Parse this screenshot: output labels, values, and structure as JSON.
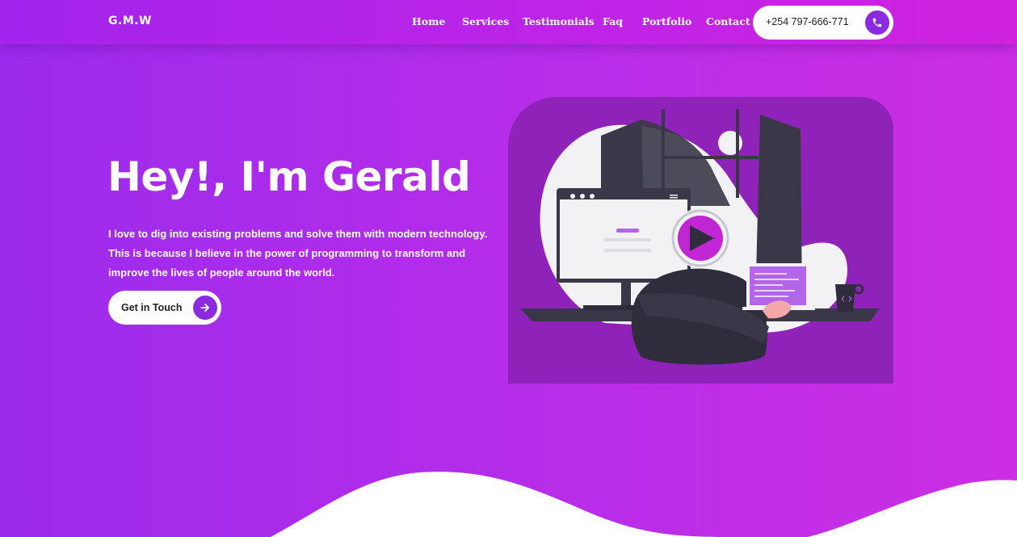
{
  "header": {
    "brand": "G.M.W",
    "nav": [
      {
        "label": "Home"
      },
      {
        "label": "Services"
      },
      {
        "label": "Testimonials"
      },
      {
        "label": "Faq"
      },
      {
        "label": "Portfolio"
      },
      {
        "label": "Contact"
      }
    ],
    "phone": "+254 797-666-771",
    "phone_icon": "phone-icon"
  },
  "hero": {
    "title": "Hey!, I'm Gerald",
    "paragraph_lines": [
      "I love to dig into existing problems and solve them with modern technology.",
      "This is because I believe in the power of programming to transform and",
      "improve the lives of people around the world."
    ],
    "cta_label": "Get in Touch",
    "cta_icon": "arrow-right-icon"
  },
  "colors": {
    "accent": "#8a2be2",
    "gradient_start": "#9c2bec",
    "gradient_end": "#cc2ee3",
    "illustration_panel": "#8f22b8",
    "play_button": "#c026d3"
  }
}
